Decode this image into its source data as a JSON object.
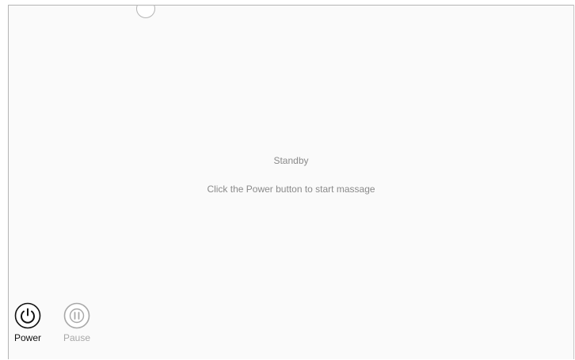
{
  "status": {
    "title": "Standby",
    "hint": "Click the Power button to start massage"
  },
  "controls": {
    "power": {
      "label": "Power",
      "icon": "power-icon",
      "color": "#111111"
    },
    "pause": {
      "label": "Pause",
      "icon": "pause-icon",
      "color": "#a8a8a8"
    }
  }
}
